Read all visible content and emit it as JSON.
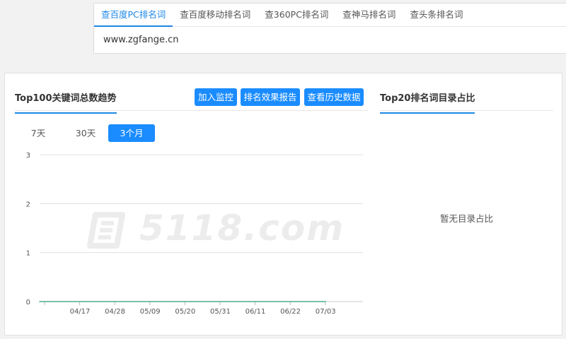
{
  "search": {
    "tabs": [
      {
        "label": "查百度PC排名词",
        "active": true
      },
      {
        "label": "查百度移动排名词",
        "active": false
      },
      {
        "label": "查360PC排名词",
        "active": false
      },
      {
        "label": "查神马排名词",
        "active": false
      },
      {
        "label": "查头条排名词",
        "active": false
      }
    ],
    "domain": "www.zgfange.cn"
  },
  "trend": {
    "title": "Top100关键词总数趋势",
    "buttons": {
      "monitor": "加入监控",
      "report": "排名效果报告",
      "history": "查看历史数据"
    },
    "ranges": [
      {
        "label": "7天",
        "active": false
      },
      {
        "label": "30天",
        "active": false
      },
      {
        "label": "3个月",
        "active": true
      }
    ],
    "watermark": "5118.com"
  },
  "directory": {
    "title": "Top20排名词目录占比",
    "empty_text": "暂无目录占比"
  },
  "colors": {
    "accent": "#1a8cff",
    "line": "#4caf8a",
    "grid": "#e0e0e0"
  },
  "chart_data": {
    "type": "line",
    "title": "",
    "xlabel": "",
    "ylabel": "",
    "ylim": [
      0,
      3
    ],
    "yticks": [
      0,
      1,
      2,
      3
    ],
    "categories": [
      "04/17",
      "04/28",
      "05/09",
      "05/20",
      "05/31",
      "06/11",
      "06/22",
      "07/03"
    ],
    "series": [
      {
        "values": [
          0,
          0,
          0,
          0,
          0,
          0,
          0,
          0
        ]
      }
    ],
    "grid": true
  }
}
